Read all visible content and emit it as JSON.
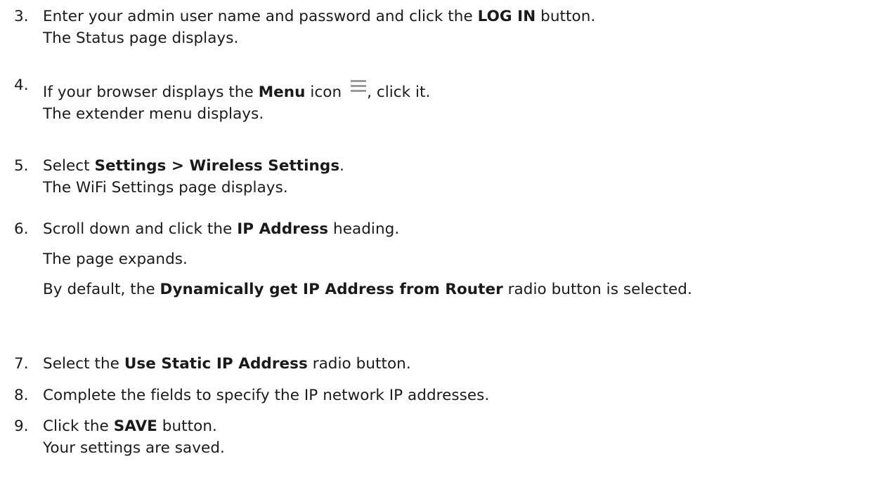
{
  "steps": [
    {
      "number": "3.",
      "parts": [
        "Enter your admin user name and password and click the ",
        "LOG IN",
        " button."
      ],
      "result": "The Status page displays."
    },
    {
      "number": "4.",
      "parts": [
        "If your browser displays the ",
        "Menu",
        " icon ",
        ", click it."
      ],
      "icon": "menu-icon",
      "result": "The extender menu displays."
    },
    {
      "number": "5.",
      "parts": [
        "Select ",
        "Settings > Wireless Settings",
        "."
      ],
      "result": "The WiFi Settings page displays."
    },
    {
      "number": "6.",
      "parts": [
        "Scroll down and click the ",
        "IP Address",
        " heading."
      ],
      "result": "The page expands.",
      "note_parts": [
        "By default, the ",
        "Dynamically get IP Address from Router",
        " radio button is selected."
      ]
    },
    {
      "number": "7.",
      "parts": [
        "Select the ",
        "Use Static IP Address",
        " radio button."
      ]
    },
    {
      "number": "8.",
      "parts": [
        "Complete the fields to specify the IP network IP addresses."
      ]
    },
    {
      "number": "9.",
      "parts": [
        "Click the ",
        "SAVE",
        " button."
      ],
      "result": "Your settings are saved."
    }
  ]
}
